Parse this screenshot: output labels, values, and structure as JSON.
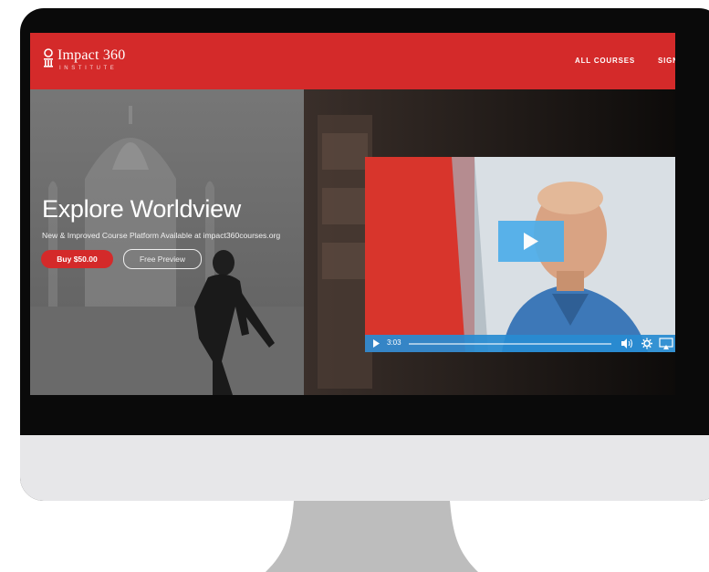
{
  "site": {
    "brand_name": "Impact 360",
    "brand_sub": "INSTITUTE",
    "nav": [
      {
        "label": "ALL COURSES"
      },
      {
        "label": "SIGN"
      }
    ]
  },
  "hero": {
    "title": "Explore Worldview",
    "subtitle": "New & Improved Course Platform Available at impact360courses.org",
    "buy_label": "Buy $50.00",
    "preview_label": "Free Preview"
  },
  "video": {
    "time": "3:03",
    "progress": 0.0,
    "colors": {
      "accent": "#4eaeea",
      "bar": "#2a8fd4"
    }
  },
  "colors": {
    "brand": "#d42a2a",
    "frame": "#0a0a0a",
    "chin": "#e7e7e9",
    "stand": "#bdbdbd"
  }
}
